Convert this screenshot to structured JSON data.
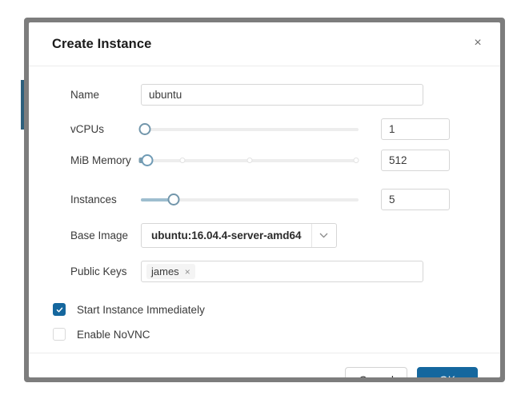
{
  "dialog": {
    "title": "Create Instance",
    "close_icon": "close-icon",
    "close_label": "×"
  },
  "form": {
    "name": {
      "label": "Name",
      "value": "ubuntu",
      "placeholder": ""
    },
    "vcpus": {
      "label": "vCPUs",
      "value": "1",
      "handle_percent": 0,
      "fill_percent": 0,
      "ticks": []
    },
    "memory": {
      "label": "MiB Memory",
      "value": "512",
      "handle_percent": 2,
      "fill_percent": 0,
      "ticks": [
        4,
        19,
        50,
        99
      ]
    },
    "instances": {
      "label": "Instances",
      "value": "5",
      "handle_percent": 15,
      "fill_percent": 15,
      "ticks": []
    },
    "base_image": {
      "label": "Base Image",
      "value": "ubuntu:16.04.4-server-amd64",
      "arrow_icon": "chevron-down-icon"
    },
    "public_keys": {
      "label": "Public Keys",
      "tags": [
        {
          "text": "james",
          "remove_label": "×"
        }
      ],
      "placeholder": ""
    },
    "start_immediately": {
      "label": "Start Instance Immediately",
      "checked": true
    },
    "enable_novnc": {
      "label": "Enable NoVNC",
      "checked": false
    }
  },
  "footer": {
    "cancel_label": "Cancel",
    "ok_label": "OK"
  },
  "colors": {
    "accent": "#15679e",
    "slider_fill": "#9ebecf",
    "slider_handle": "#7296ab",
    "frame": "#7d7d7d",
    "background_bar": "#2c5f7c"
  }
}
